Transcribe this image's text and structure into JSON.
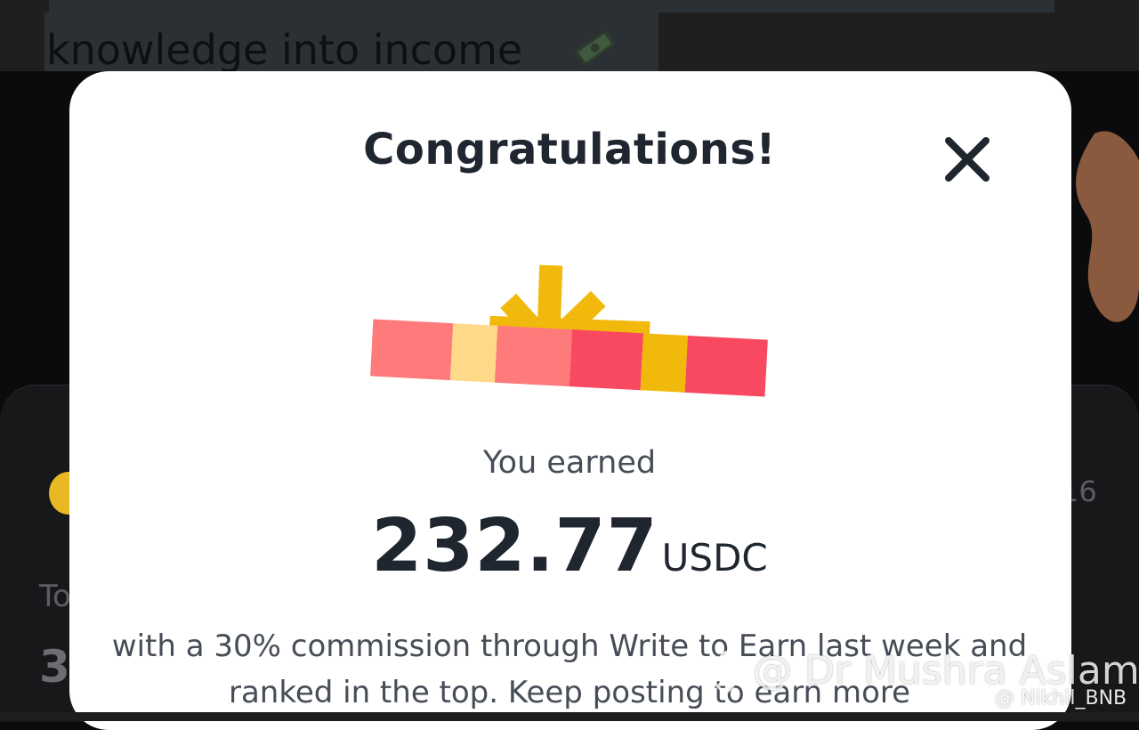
{
  "background": {
    "headline": "knowledge into income",
    "money_icon": "money-bag-icon",
    "side_text_to": "To",
    "side_text_three": "3",
    "side_text_date": "16"
  },
  "modal": {
    "title": "Congratulations!",
    "close_icon": "close-icon",
    "gift_icon": "gift-box-icon",
    "earned_label": "You earned",
    "amount": "232.77",
    "currency": "USDC",
    "description": "with a 30% commission through Write to Earn last week and ranked in the top. Keep posting to earn more"
  },
  "watermarks": {
    "main": "@ Dr Mushra Aslam",
    "sub": "@ Nikhil_BNB"
  },
  "colors": {
    "modal_bg": "#ffffff",
    "title_text": "#202630",
    "body_text": "#474d57",
    "gift_gold": "#f0b90b",
    "gift_red": "#f84960",
    "gift_pink": "#ff7a7a",
    "gift_cream": "#ffd98a"
  }
}
